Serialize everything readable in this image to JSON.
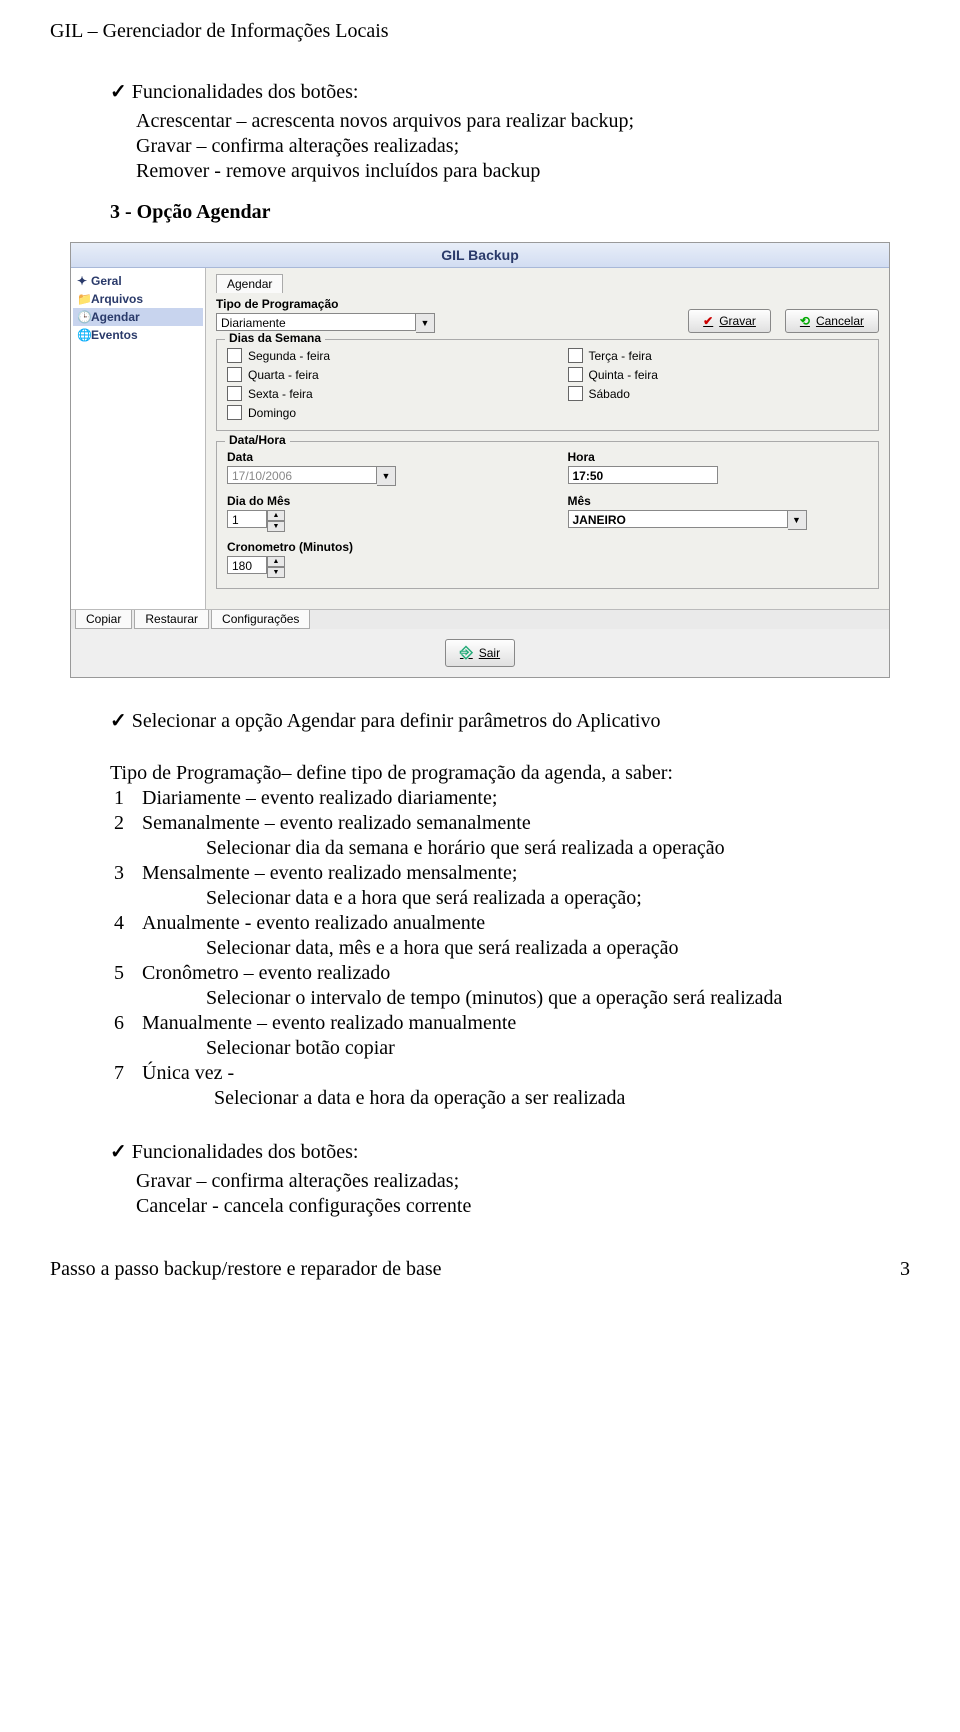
{
  "header": "GIL – Gerenciador de Informações Locais",
  "intro": {
    "title": "Funcionalidades dos botões:",
    "line1": "Acrescentar – acrescenta novos arquivos para realizar backup;",
    "line2": "Gravar – confirma alterações realizadas;",
    "line3": "Remover -   remove arquivos incluídos para backup"
  },
  "section3": "3 - Opção Agendar",
  "screenshot": {
    "title": "GIL Backup",
    "sidebar": {
      "geral": "Geral",
      "arquivos": "Arquivos",
      "agendar": "Agendar",
      "eventos": "Eventos"
    },
    "tab_agendar": "Agendar",
    "tipo_label": "Tipo de Programação",
    "tipo_value": "Diariamente",
    "btn_gravar": "Gravar",
    "btn_cancelar": "Cancelar",
    "dias_label": "Dias da Semana",
    "days": {
      "seg": "Segunda - feira",
      "ter": "Terça - feira",
      "qua": "Quarta - feira",
      "qui": "Quinta - feira",
      "sex": "Sexta - feira",
      "sab": "Sábado",
      "dom": "Domingo"
    },
    "datahora_label": "Data/Hora",
    "data_label": "Data",
    "data_value": "17/10/2006",
    "hora_label": "Hora",
    "hora_value": "17:50",
    "diames_label": "Dia do Mês",
    "diames_value": "1",
    "mes_label": "Mês",
    "mes_value": "JANEIRO",
    "crono_label": "Cronometro (Minutos)",
    "crono_value": "180",
    "btab_copiar": "Copiar",
    "btab_restaurar": "Restaurar",
    "btab_config": "Configurações",
    "btn_sair": "Sair"
  },
  "after": {
    "check1": "Selecionar a opção Agendar para definir parâmetros do Aplicativo",
    "p1": "Tipo de Programação– define tipo de programação da agenda, a saber:",
    "items": {
      "n1": "1",
      "t1": "Diariamente – evento realizado diariamente;",
      "n2": "2",
      "t2": "Semanalmente – evento realizado semanalmente",
      "s2": "Selecionar dia da semana e horário que será realizada a operação",
      "n3": "3",
      "t3": "Mensalmente – evento realizado mensalmente;",
      "s3": "Selecionar data e a hora que será realizada a operação;",
      "n4": "4",
      "t4": "Anualmente -  evento realizado anualmente",
      "s4": "Selecionar data, mês e a hora que será realizada a operação",
      "n5": "5",
      "t5": "Cronômetro – evento realizado",
      "s5": "Selecionar o intervalo de tempo (minutos) que a operação será realizada",
      "n6": "6",
      "t6": "Manualmente – evento realizado manualmente",
      "s6": "Selecionar botão copiar",
      "n7": "7",
      "t7": "Única vez -",
      "s7": "Selecionar a data e hora da operação a ser realizada"
    },
    "func_title": "Funcionalidades dos botões:",
    "func1": "Gravar – confirma alterações realizadas;",
    "func2": "Cancelar -  cancela configurações corrente"
  },
  "footer": {
    "left": "Passo a passo backup/restore e reparador de base",
    "right": "3"
  }
}
